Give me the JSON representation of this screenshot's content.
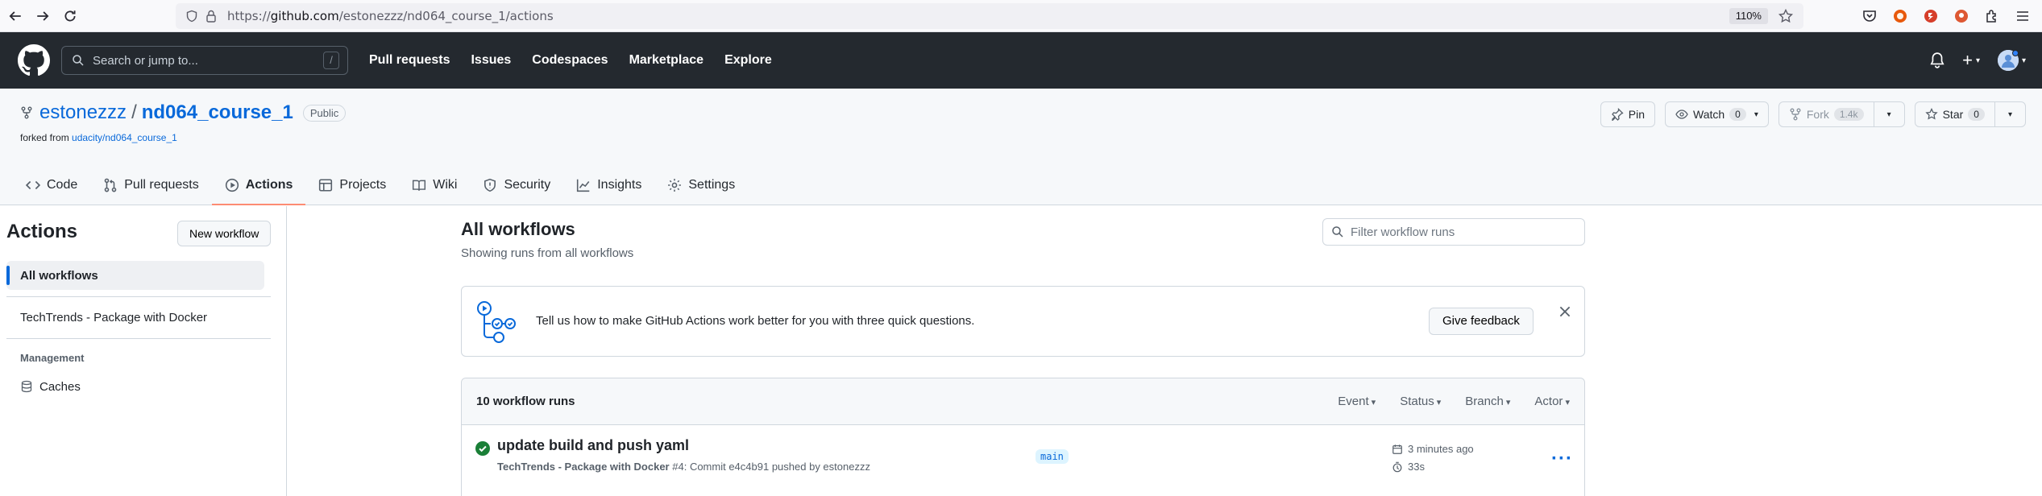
{
  "browser": {
    "url_prefix": "https://",
    "url_host": "github.com",
    "url_path": "/estonezzz/nd064_course_1/actions",
    "zoom": "110%"
  },
  "header": {
    "search_placeholder": "Search or jump to...",
    "search_key": "/",
    "nav": [
      "Pull requests",
      "Issues",
      "Codespaces",
      "Marketplace",
      "Explore"
    ],
    "new_menu": "+"
  },
  "repo": {
    "owner": "estonezzz",
    "separator": "/",
    "name": "nd064_course_1",
    "visibility": "Public",
    "forked_prefix": "forked from",
    "forked_source": "udacity/nd064_course_1",
    "pin_label": "Pin",
    "watch_label": "Watch",
    "watch_count": "0",
    "fork_label": "Fork",
    "fork_count": "1.4k",
    "star_label": "Star",
    "star_count": "0",
    "tabs": [
      "Code",
      "Pull requests",
      "Actions",
      "Projects",
      "Wiki",
      "Security",
      "Insights",
      "Settings"
    ]
  },
  "sidebar": {
    "title": "Actions",
    "new_workflow": "New workflow",
    "items": [
      "All workflows",
      "TechTrends - Package with Docker"
    ],
    "section_label": "Management",
    "management_items": [
      "Caches"
    ]
  },
  "main": {
    "title": "All workflows",
    "subtitle": "Showing runs from all workflows",
    "filter_placeholder": "Filter workflow runs",
    "feedback_text": "Tell us how to make GitHub Actions work better for you with three quick questions.",
    "feedback_button": "Give feedback",
    "runs_count": "10 workflow runs",
    "run_filters": [
      "Event",
      "Status",
      "Branch",
      "Actor"
    ],
    "runs": [
      {
        "title": "update build and push yaml",
        "workflow": "TechTrends - Package with Docker",
        "number": "#4",
        "meta_rest": ": Commit e4c4b91 pushed by estonezzz",
        "branch": "main",
        "time": "3 minutes ago",
        "duration": "33s",
        "status": "success"
      }
    ]
  },
  "colors": {
    "header_bg": "#24292f",
    "link": "#0969da",
    "active_tab": "#fd8c73",
    "success": "#1a7f37"
  }
}
